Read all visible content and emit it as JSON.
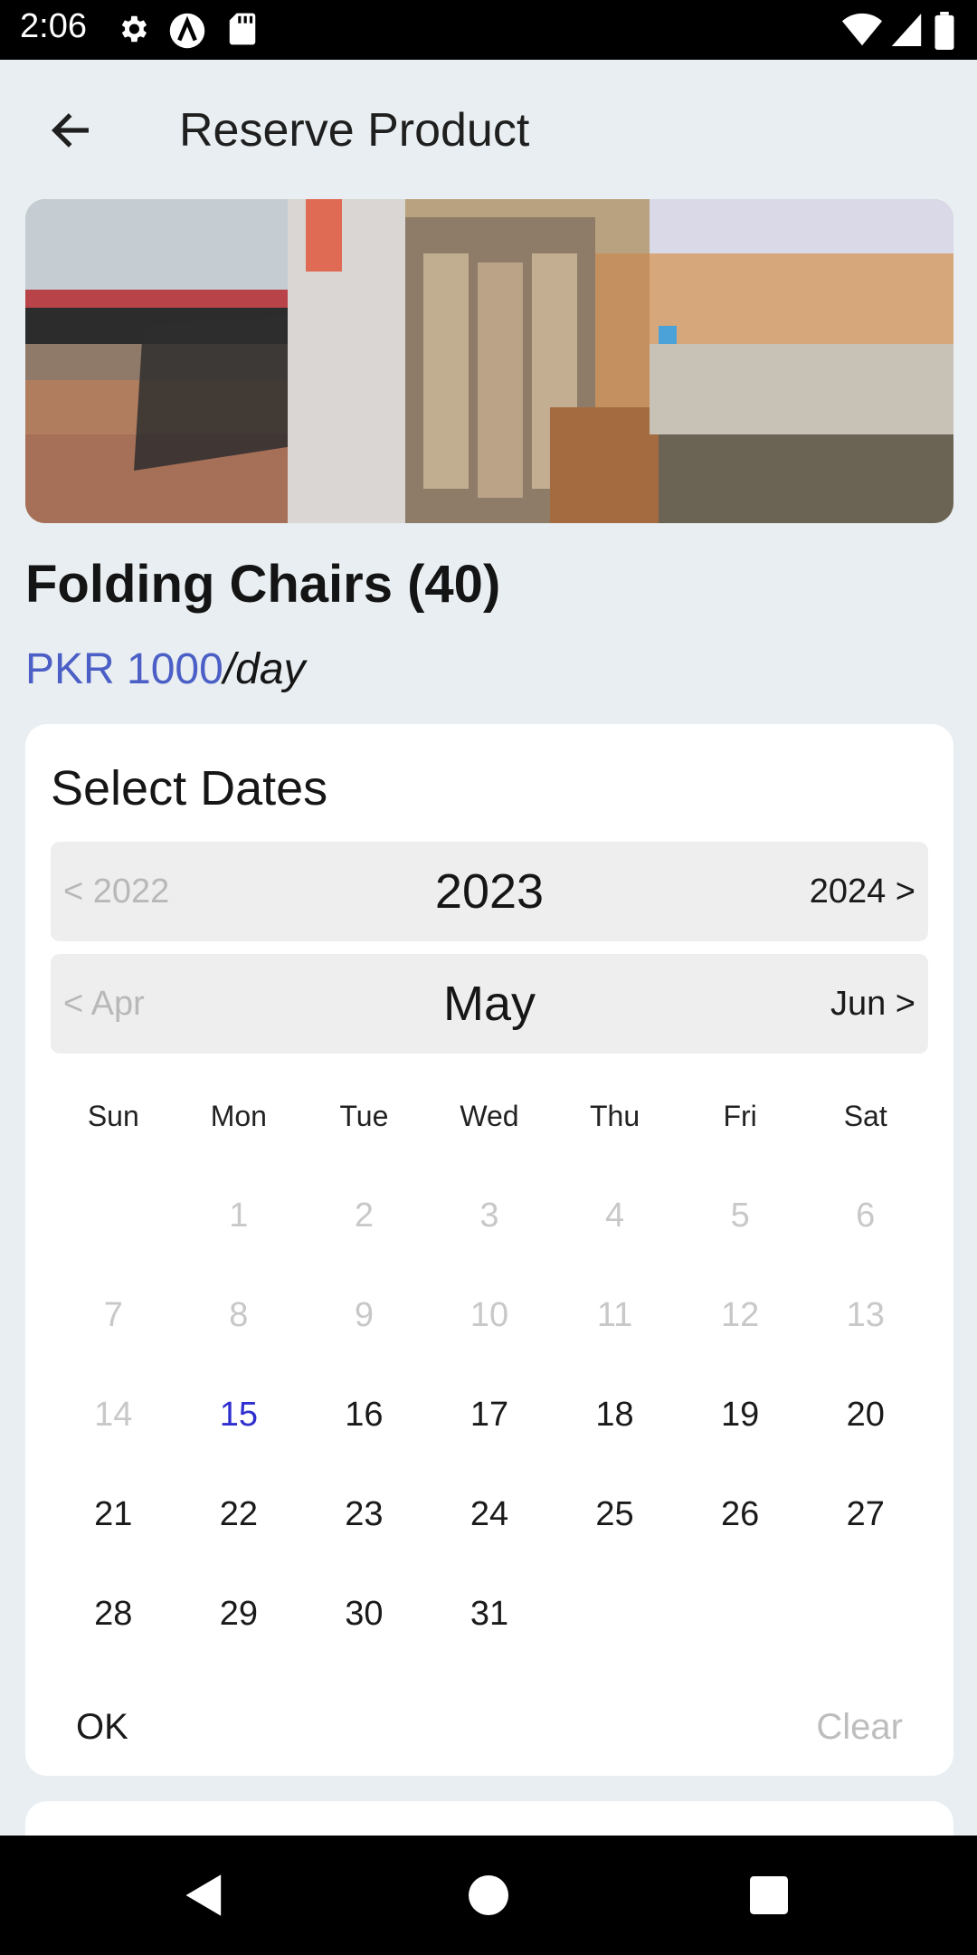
{
  "status_bar": {
    "time": "2:06",
    "left_icons": [
      "gear-icon",
      "app-a-icon",
      "sd-card-icon"
    ],
    "right_icons": [
      "wifi-icon",
      "signal-icon",
      "battery-icon"
    ]
  },
  "app_bar": {
    "back_icon": "arrow-left-icon",
    "title": "Reserve Product"
  },
  "product": {
    "name": "Folding Chairs (40)",
    "price_amount": "PKR 1000",
    "price_unit": "/day",
    "price_color": "#4b5fc6"
  },
  "date_picker": {
    "title": "Select Dates",
    "year": {
      "prev": "< 2022",
      "current": "2023",
      "next": "2024 >"
    },
    "month": {
      "prev": "< Apr",
      "current": "May",
      "next": "Jun >"
    },
    "weekdays": [
      "Sun",
      "Mon",
      "Tue",
      "Wed",
      "Thu",
      "Fri",
      "Sat"
    ],
    "days": [
      {
        "label": "",
        "state": "empty"
      },
      {
        "label": "1",
        "state": "disabled"
      },
      {
        "label": "2",
        "state": "disabled"
      },
      {
        "label": "3",
        "state": "disabled"
      },
      {
        "label": "4",
        "state": "disabled"
      },
      {
        "label": "5",
        "state": "disabled"
      },
      {
        "label": "6",
        "state": "disabled"
      },
      {
        "label": "7",
        "state": "disabled"
      },
      {
        "label": "8",
        "state": "disabled"
      },
      {
        "label": "9",
        "state": "disabled"
      },
      {
        "label": "10",
        "state": "disabled"
      },
      {
        "label": "11",
        "state": "disabled"
      },
      {
        "label": "12",
        "state": "disabled"
      },
      {
        "label": "13",
        "state": "disabled"
      },
      {
        "label": "14",
        "state": "disabled"
      },
      {
        "label": "15",
        "state": "today"
      },
      {
        "label": "16",
        "state": "enabled"
      },
      {
        "label": "17",
        "state": "enabled"
      },
      {
        "label": "18",
        "state": "enabled"
      },
      {
        "label": "19",
        "state": "enabled"
      },
      {
        "label": "20",
        "state": "enabled"
      },
      {
        "label": "21",
        "state": "enabled"
      },
      {
        "label": "22",
        "state": "enabled"
      },
      {
        "label": "23",
        "state": "enabled"
      },
      {
        "label": "24",
        "state": "enabled"
      },
      {
        "label": "25",
        "state": "enabled"
      },
      {
        "label": "26",
        "state": "enabled"
      },
      {
        "label": "27",
        "state": "enabled"
      },
      {
        "label": "28",
        "state": "enabled"
      },
      {
        "label": "29",
        "state": "enabled"
      },
      {
        "label": "30",
        "state": "enabled"
      },
      {
        "label": "31",
        "state": "enabled"
      }
    ],
    "ok_label": "OK",
    "clear_label": "Clear",
    "today_color": "#2f2fd0"
  },
  "nav_bar": {
    "icons": [
      "back-triangle-icon",
      "home-circle-icon",
      "recents-square-icon"
    ]
  }
}
